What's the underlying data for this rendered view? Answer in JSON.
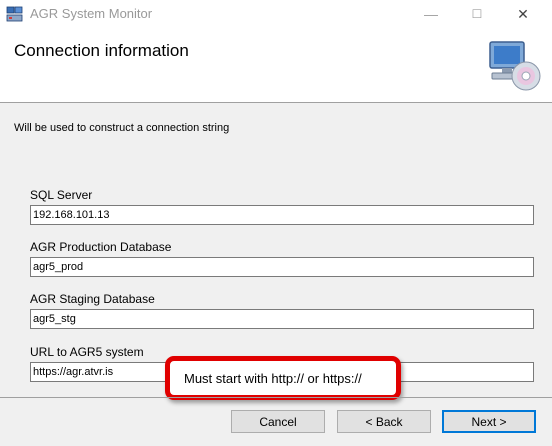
{
  "window": {
    "title": "AGR System Monitor",
    "minimize_glyph": "—",
    "maximize_glyph": "☐",
    "close_glyph": "✕"
  },
  "header": {
    "title": "Connection information",
    "graphic_icon": "computer-with-disc-icon"
  },
  "subtitle": "Will be used to construct a connection string",
  "fields": {
    "sql_server": {
      "label": "SQL Server",
      "value": "192.168.101.13"
    },
    "production_db": {
      "label": "AGR Production Database",
      "value": "agr5_prod"
    },
    "staging_db": {
      "label": "AGR Staging Database",
      "value": "agr5_stg"
    },
    "url": {
      "label": "URL to AGR5 system",
      "value": "https://agr.atvr.is"
    }
  },
  "callout": {
    "text": "Must start with http:// or https://",
    "border_color": "#e00000"
  },
  "buttons": {
    "cancel": "Cancel",
    "back": "< Back",
    "next": "Next >"
  },
  "colors": {
    "accent": "#0078d7"
  }
}
